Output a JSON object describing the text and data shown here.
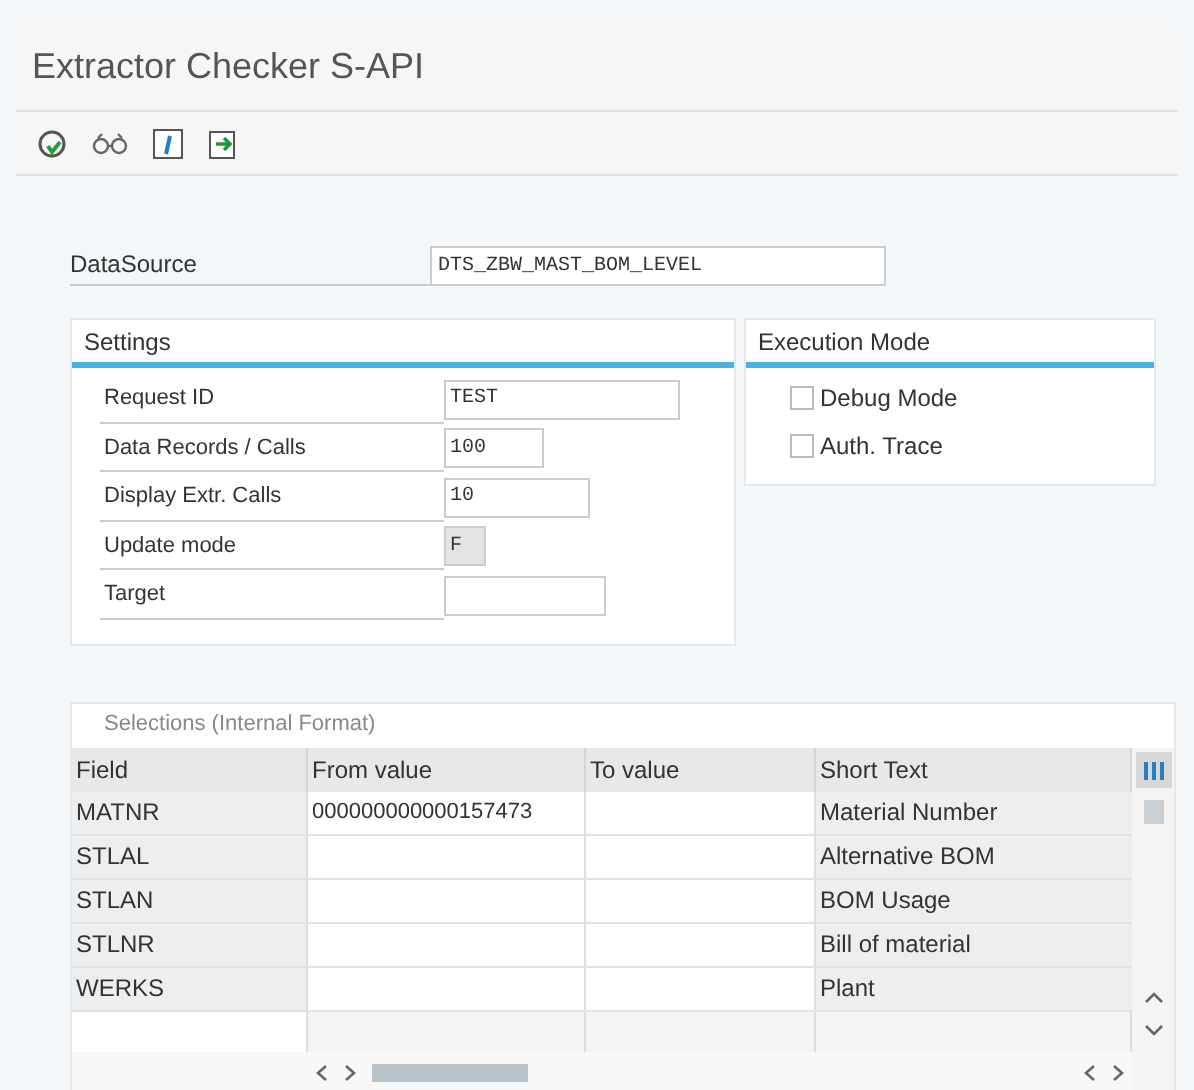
{
  "window": {
    "title": "Extractor Checker S-API"
  },
  "datasource": {
    "label": "DataSource",
    "value": "DTS_ZBW_MAST_BOM_LEVEL"
  },
  "settings": {
    "title": "Settings",
    "fields": [
      {
        "label": "Request ID",
        "value": "TEST",
        "disabled": false
      },
      {
        "label": "Data Records / Calls",
        "value": "100",
        "disabled": false
      },
      {
        "label": "Display Extr. Calls",
        "value": "10",
        "disabled": false
      },
      {
        "label": "Update mode",
        "value": "F",
        "disabled": true
      },
      {
        "label": "Target",
        "disabled": false
      }
    ]
  },
  "execution_mode": {
    "title": "Execution Mode",
    "options": [
      {
        "label": "Debug Mode",
        "checked": false
      },
      {
        "label": "Auth. Trace",
        "checked": false
      }
    ]
  },
  "selections": {
    "title": "Selections (Internal Format)",
    "columns": [
      "Field",
      "From value",
      "To value",
      "Short Text"
    ],
    "rows": [
      {
        "field": "MATNR",
        "from": "000000000000157473",
        "short_text": "Material Number"
      },
      {
        "field": "STLAL",
        "short_text": "Alternative BOM"
      },
      {
        "field": "STLAN",
        "short_text": "BOM Usage"
      },
      {
        "field": "STLNR",
        "short_text": "Bill of material"
      },
      {
        "field": "WERKS",
        "short_text": "Plant"
      }
    ]
  }
}
